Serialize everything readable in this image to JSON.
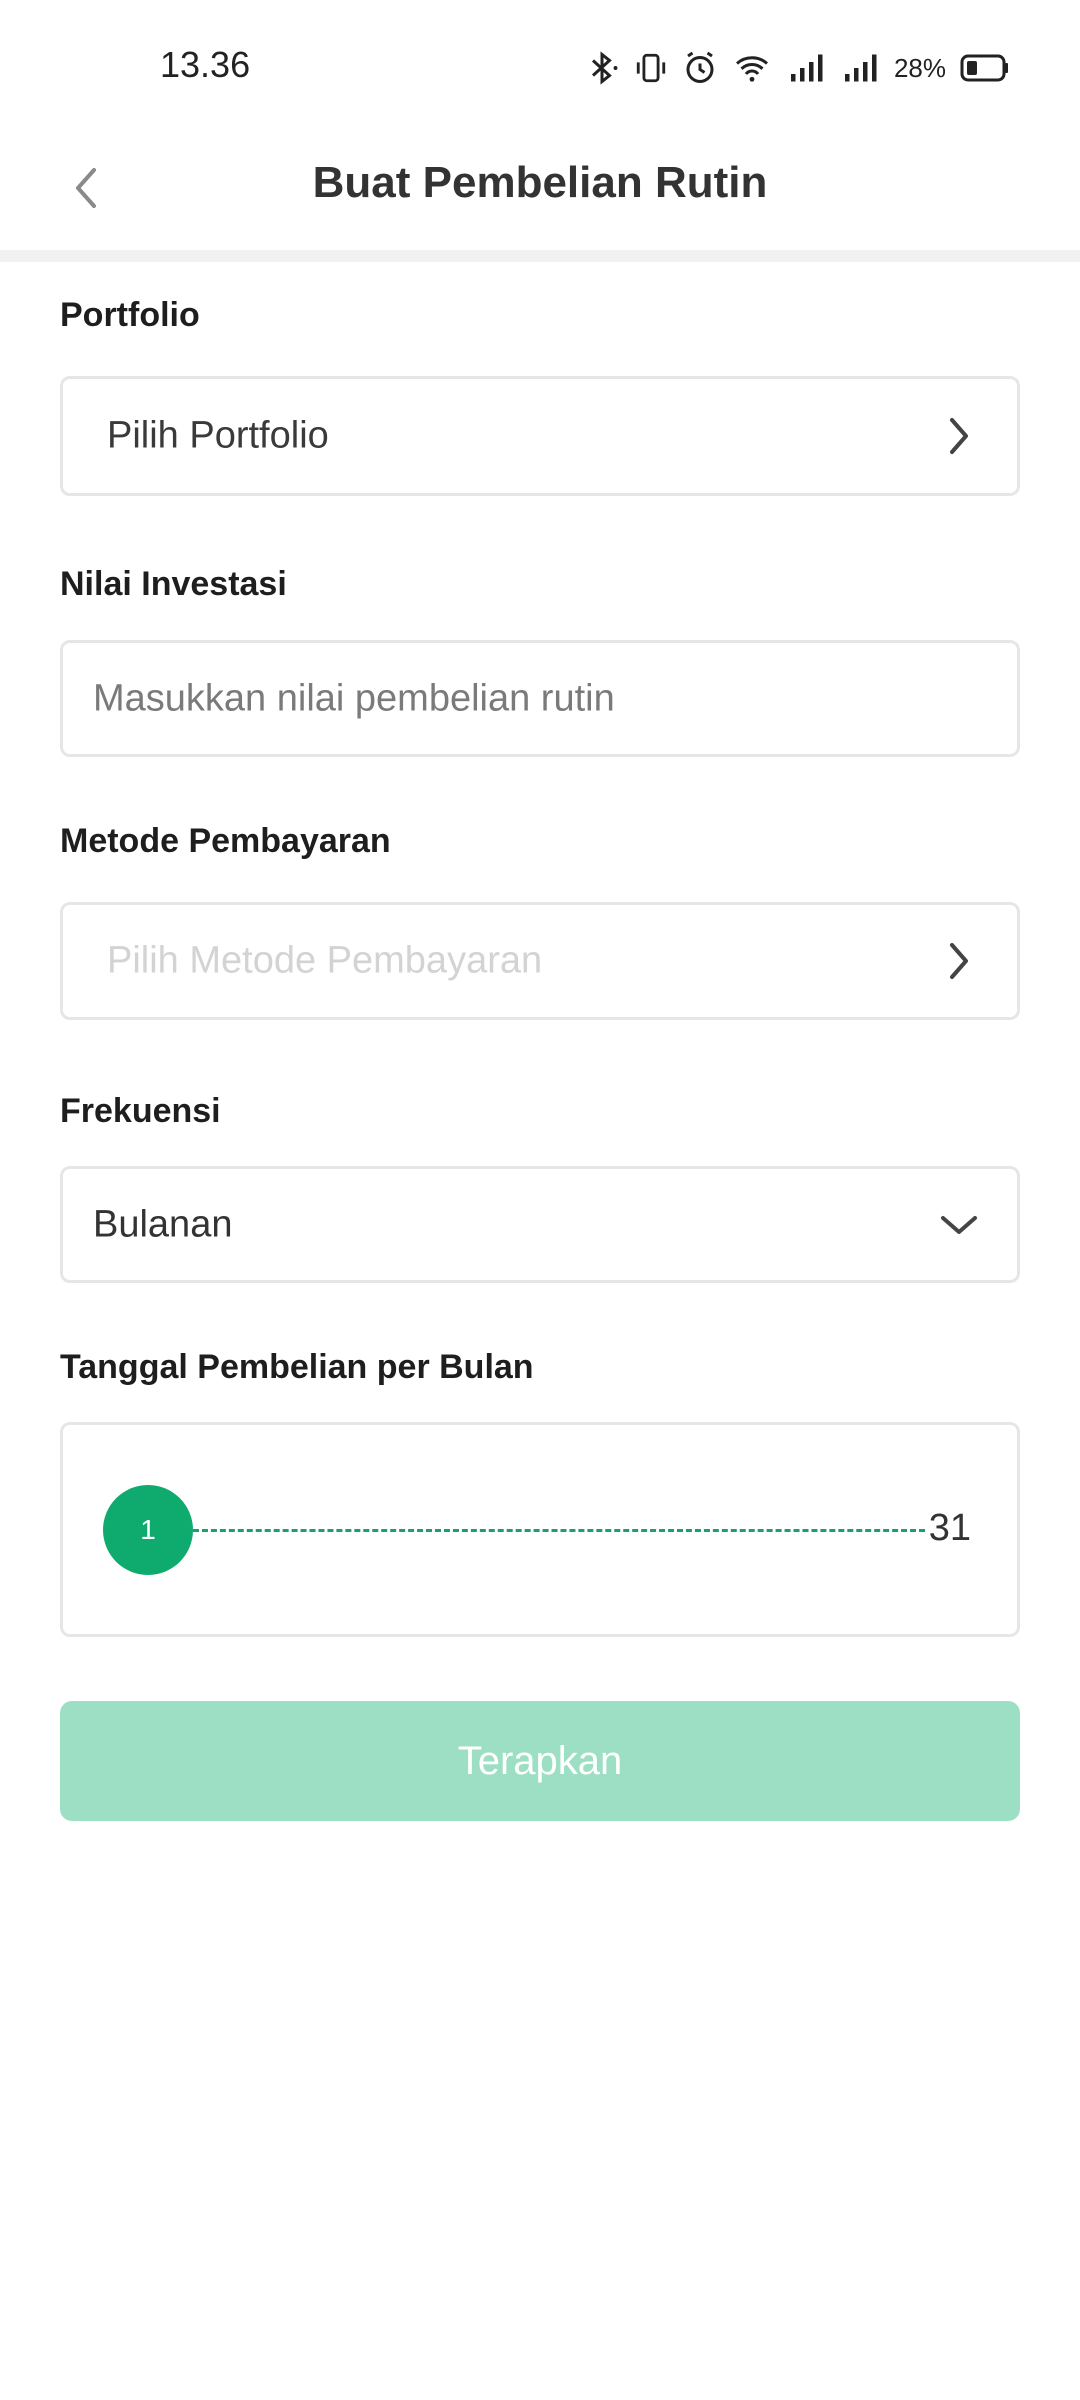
{
  "status_bar": {
    "time": "13.36",
    "battery_percent": "28%",
    "icons": [
      "bluetooth-icon",
      "vibrate-icon",
      "alarm-icon",
      "wifi-icon",
      "signal-icon",
      "signal-icon",
      "battery-icon"
    ]
  },
  "header": {
    "title": "Buat Pembelian Rutin",
    "back_icon": "chevron-left-icon"
  },
  "form": {
    "portfolio": {
      "label": "Portfolio",
      "value": "Pilih Portfolio"
    },
    "nilai_investasi": {
      "label": "Nilai Investasi",
      "placeholder": "Masukkan nilai pembelian rutin"
    },
    "metode_pembayaran": {
      "label": "Metode Pembayaran",
      "placeholder": "Pilih Metode Pembayaran"
    },
    "frekuensi": {
      "label": "Frekuensi",
      "value": "Bulanan"
    },
    "tanggal": {
      "label": "Tanggal Pembelian per Bulan",
      "selected": "1",
      "max": "31"
    }
  },
  "apply_button": {
    "label": "Terapkan"
  },
  "colors": {
    "accent": "#0faa6e",
    "button_disabled": "#9ddfc5",
    "border": "#e6e6e6"
  }
}
